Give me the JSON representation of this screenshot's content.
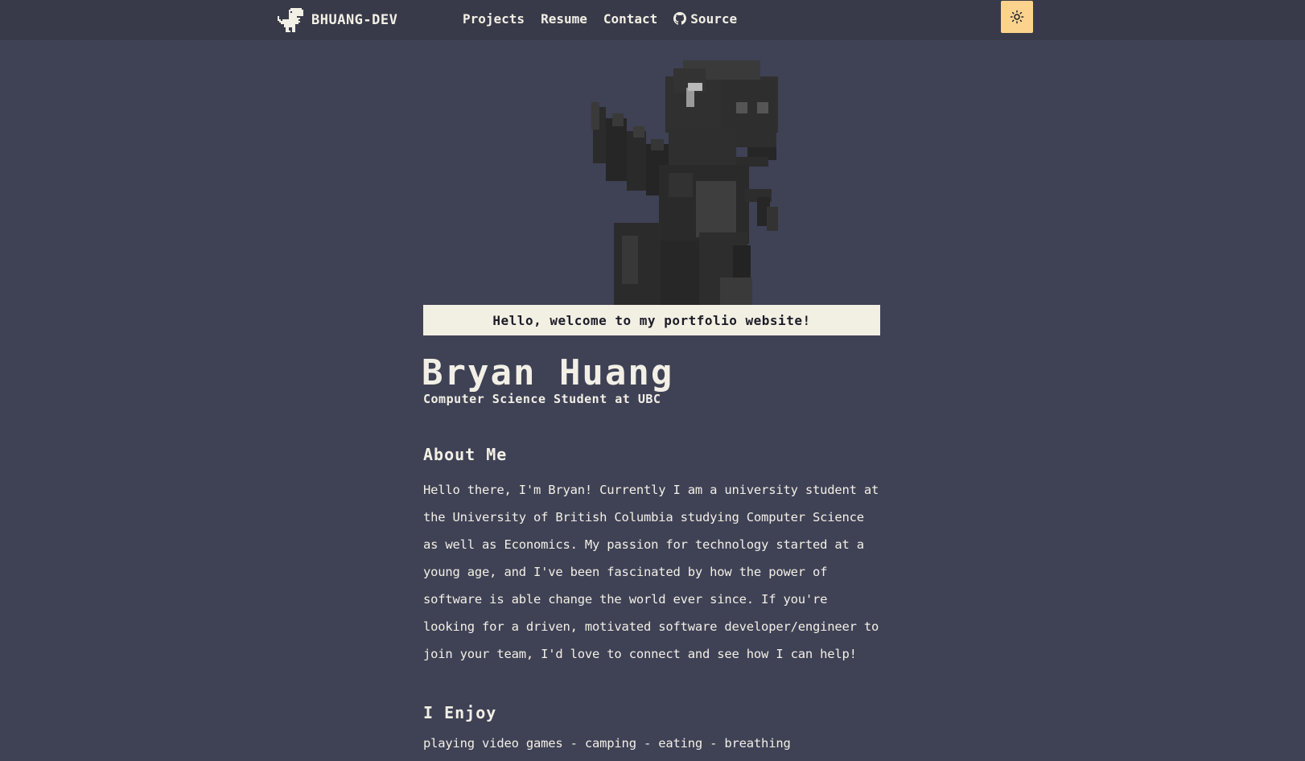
{
  "nav": {
    "brand": "BHUANG-DEV",
    "links": [
      {
        "label": "Projects"
      },
      {
        "label": "Resume"
      },
      {
        "label": "Contact"
      },
      {
        "label": "Source",
        "icon": "github-icon"
      }
    ],
    "theme_toggle_icon": "sun-icon"
  },
  "hero": {
    "image": "pixel-dinosaur-3d",
    "welcome": "Hello, welcome to my portfolio website!"
  },
  "profile": {
    "name": "Bryan Huang",
    "subtitle": "Computer Science Student at UBC"
  },
  "about": {
    "heading": "About Me",
    "text": "Hello there, I'm Bryan! Currently I am a university student at the University of British Columbia studying Computer Science as well as Economics. My passion for technology started at a young age, and I've been fascinated by how the power of software is able change the world ever since. If you're looking for a driven, motivated software developer/engineer to join your team, I'd love to connect and see how I can help!"
  },
  "enjoy": {
    "heading": "I Enjoy",
    "text": "playing video games - camping - eating - breathing"
  },
  "colors": {
    "background": "#3f4155",
    "navbar": "#393a49",
    "toggle": "#fbd38d",
    "welcome_bg": "#f2efe3",
    "text": "#f2f0e6"
  }
}
